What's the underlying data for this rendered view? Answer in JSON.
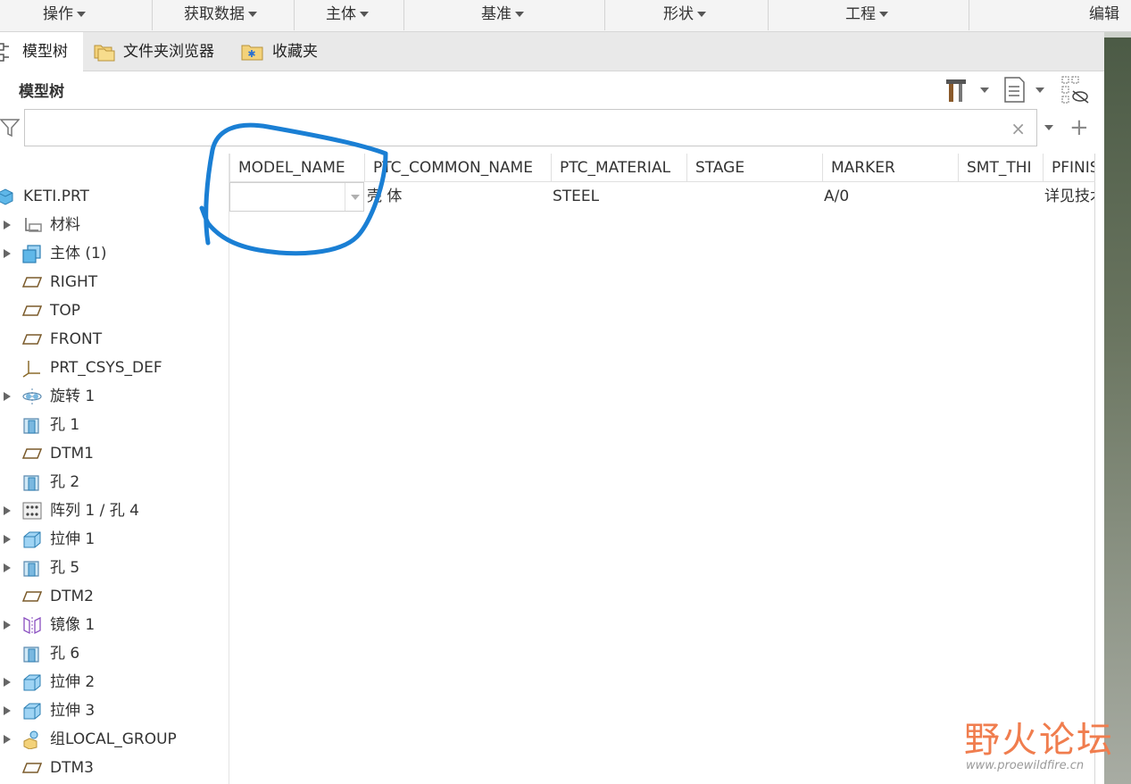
{
  "menubar": {
    "items": [
      {
        "label": "操作"
      },
      {
        "label": "获取数据"
      },
      {
        "label": "主体"
      },
      {
        "label": "基准"
      },
      {
        "label": "形状"
      },
      {
        "label": "工程"
      },
      {
        "label": "编辑"
      }
    ]
  },
  "tabs": [
    {
      "label": "模型树",
      "icon": "model-tree-icon",
      "active": true
    },
    {
      "label": "文件夹浏览器",
      "icon": "folder-browser-icon",
      "active": false
    },
    {
      "label": "收藏夹",
      "icon": "favorites-icon",
      "active": false
    }
  ],
  "panel": {
    "title": "模型树"
  },
  "search": {
    "value": "",
    "placeholder": "",
    "clear_glyph": "×",
    "add_glyph": "+"
  },
  "tree": {
    "root": {
      "label": "KETI.PRT",
      "icon": "part-icon"
    },
    "items": [
      {
        "label": "材料",
        "icon": "material-icon",
        "expandable": true
      },
      {
        "label": "主体 (1)",
        "icon": "body-icon",
        "expandable": true
      },
      {
        "label": "RIGHT",
        "icon": "datum-plane-icon",
        "expandable": false
      },
      {
        "label": "TOP",
        "icon": "datum-plane-icon",
        "expandable": false
      },
      {
        "label": "FRONT",
        "icon": "datum-plane-icon",
        "expandable": false
      },
      {
        "label": "PRT_CSYS_DEF",
        "icon": "coordinate-system-icon",
        "expandable": false
      },
      {
        "label": "旋转 1",
        "icon": "revolve-icon",
        "expandable": true
      },
      {
        "label": "孔 1",
        "icon": "hole-icon",
        "expandable": false
      },
      {
        "label": "DTM1",
        "icon": "datum-plane-icon",
        "expandable": false
      },
      {
        "label": "孔 2",
        "icon": "hole-icon",
        "expandable": false
      },
      {
        "label": "阵列 1 / 孔 4",
        "icon": "pattern-icon",
        "expandable": true
      },
      {
        "label": "拉伸 1",
        "icon": "extrude-icon",
        "expandable": true
      },
      {
        "label": "孔 5",
        "icon": "hole-icon",
        "expandable": true
      },
      {
        "label": "DTM2",
        "icon": "datum-plane-icon",
        "expandable": false
      },
      {
        "label": "镜像 1",
        "icon": "mirror-icon",
        "expandable": true
      },
      {
        "label": "孔 6",
        "icon": "hole-icon",
        "expandable": false
      },
      {
        "label": "拉伸 2",
        "icon": "extrude-icon",
        "expandable": true
      },
      {
        "label": "拉伸 3",
        "icon": "extrude-icon",
        "expandable": true
      },
      {
        "label": "组LOCAL_GROUP",
        "icon": "group-icon",
        "expandable": true
      },
      {
        "label": "DTM3",
        "icon": "datum-plane-icon",
        "expandable": false
      }
    ]
  },
  "table": {
    "columns": [
      "MODEL_NAME",
      "PTC_COMMON_NAME",
      "PTC_MATERIAL",
      "STAGE",
      "MARKER",
      "SMT_THI",
      "PFINISH"
    ],
    "row": {
      "MODEL_NAME": "",
      "PTC_COMMON_NAME": "壳  体",
      "PTC_MATERIAL": "STEEL",
      "STAGE": "",
      "MARKER": "A/0",
      "SMT_THI": "",
      "PFINISH": "详见技术"
    }
  },
  "watermark": {
    "title": "野火论坛",
    "url": "www.proewildfire.cn"
  },
  "colors": {
    "annotation": "#1a7fd4",
    "watermark": "#f07d4e"
  }
}
